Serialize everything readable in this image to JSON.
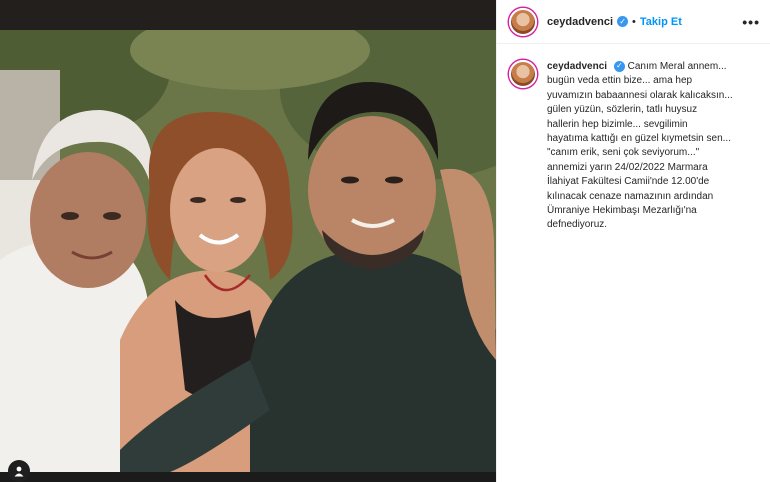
{
  "post": {
    "username": "ceydadvenci",
    "follow_label": "Takip Et",
    "separator": "•",
    "more_label": "•••",
    "caption_line1": "Canım Meral annem...",
    "caption_rest": "bugün veda ettin bize... ama hep\nyuvamızın babaannesi olarak kalıcaksın...\ngülen yüzün, sözlerin, tatlı huysuz\nhallerin hep bizimle... sevgilimin\nhayatıma kattığı en güzel kıymetsin sen...\n\"canım erik, seni çok seviyorum...\"\nannemizi yarın 24/02/2022 Marmara\nİlahiyat Fakültesi Camii'nde 12.00'de\nkılınacak cenaze namazının ardından\nÜmraniye Hekimbaşı Mezarlığı'na\ndefnediyoruz."
  },
  "icons": {
    "verified": "verified-badge-icon",
    "tag": "user-tag-icon",
    "more": "more-options-icon"
  },
  "colors": {
    "follow": "#0095f6",
    "verified": "#3897f0"
  }
}
